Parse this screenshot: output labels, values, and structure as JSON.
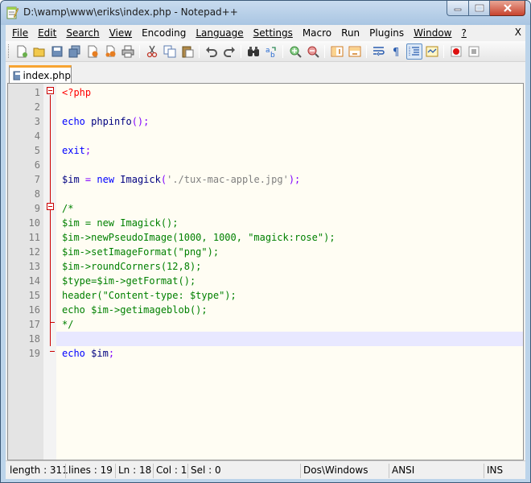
{
  "window": {
    "title": "D:\\wamp\\www\\eriks\\index.php - Notepad++"
  },
  "menu": {
    "items": [
      {
        "label": "File"
      },
      {
        "label": "Edit"
      },
      {
        "label": "Search"
      },
      {
        "label": "View"
      },
      {
        "label": "Encoding"
      },
      {
        "label": "Language"
      },
      {
        "label": "Settings"
      },
      {
        "label": "Macro"
      },
      {
        "label": "Run"
      },
      {
        "label": "Plugins"
      },
      {
        "label": "Window"
      },
      {
        "label": "?"
      }
    ],
    "close_label": "X"
  },
  "toolbar": {
    "buttons": [
      "new-file-icon",
      "open-file-icon",
      "save-icon",
      "save-all-icon",
      "close-icon",
      "close-all-icon",
      "print-icon",
      "cut-icon",
      "copy-icon",
      "paste-icon",
      "undo-icon",
      "redo-icon",
      "find-icon",
      "replace-icon",
      "zoom-in-icon",
      "zoom-out-icon",
      "sync-vertical-icon",
      "sync-horizontal-icon",
      "word-wrap-icon",
      "show-all-chars-icon",
      "indent-guide-icon",
      "user-lang-icon",
      "record-macro-icon",
      "stop-macro-icon"
    ],
    "active": "indent-guide-icon"
  },
  "tabs": [
    {
      "label": "index.php",
      "active": true
    }
  ],
  "editor": {
    "current_line": 18,
    "lines": [
      {
        "num": "1",
        "tokens": [
          {
            "t": "<?php",
            "c": "c-php"
          }
        ]
      },
      {
        "num": "2",
        "tokens": []
      },
      {
        "num": "3",
        "tokens": [
          {
            "t": "echo",
            "c": "c-kw"
          },
          {
            "t": " phpinfo",
            "c": "c-fn"
          },
          {
            "t": "();",
            "c": "c-op"
          }
        ]
      },
      {
        "num": "4",
        "tokens": []
      },
      {
        "num": "5",
        "tokens": [
          {
            "t": "exit",
            "c": "c-kw"
          },
          {
            "t": ";",
            "c": "c-op"
          }
        ]
      },
      {
        "num": "6",
        "tokens": []
      },
      {
        "num": "7",
        "tokens": [
          {
            "t": "$im",
            "c": "c-var"
          },
          {
            "t": " = ",
            "c": "c-op"
          },
          {
            "t": "new",
            "c": "c-kw"
          },
          {
            "t": " Imagick",
            "c": "c-fn"
          },
          {
            "t": "(",
            "c": "c-op"
          },
          {
            "t": "'./tux-mac-apple.jpg'",
            "c": "c-str"
          },
          {
            "t": ");",
            "c": "c-op"
          }
        ]
      },
      {
        "num": "8",
        "tokens": []
      },
      {
        "num": "9",
        "tokens": [
          {
            "t": "/*",
            "c": "c-cm"
          }
        ]
      },
      {
        "num": "10",
        "tokens": [
          {
            "t": "$im = new Imagick();",
            "c": "c-cm"
          }
        ]
      },
      {
        "num": "11",
        "tokens": [
          {
            "t": "$im->newPseudoImage(1000, 1000, \"magick:rose\");",
            "c": "c-cm"
          }
        ]
      },
      {
        "num": "12",
        "tokens": [
          {
            "t": "$im->setImageFormat(\"png\");",
            "c": "c-cm"
          }
        ]
      },
      {
        "num": "13",
        "tokens": [
          {
            "t": "$im->roundCorners(12,8);",
            "c": "c-cm"
          }
        ]
      },
      {
        "num": "14",
        "tokens": [
          {
            "t": "$type=$im->getFormat();",
            "c": "c-cm"
          }
        ]
      },
      {
        "num": "15",
        "tokens": [
          {
            "t": "header(\"Content-type: $type\");",
            "c": "c-cm"
          }
        ]
      },
      {
        "num": "16",
        "tokens": [
          {
            "t": "echo $im->getimageblob();",
            "c": "c-cm"
          }
        ]
      },
      {
        "num": "17",
        "tokens": [
          {
            "t": "*/",
            "c": "c-cm"
          }
        ]
      },
      {
        "num": "18",
        "tokens": []
      },
      {
        "num": "19",
        "tokens": [
          {
            "t": "echo",
            "c": "c-kw"
          },
          {
            "t": " $im",
            "c": "c-var"
          },
          {
            "t": ";",
            "c": "c-op"
          }
        ]
      }
    ]
  },
  "status": {
    "length": "length : 311",
    "lines": "lines : 19",
    "ln": "Ln : 18",
    "col": "Col : 1",
    "sel": "Sel : 0",
    "eol": "Dos\\Windows",
    "encoding": "ANSI",
    "mode": "INS"
  },
  "colors": {
    "php_tag": "#ff0000",
    "keyword": "#0000ff",
    "comment": "#008000",
    "string": "#808080",
    "current_line": "#e8e8ff",
    "tab_accent": "#f7a432"
  }
}
